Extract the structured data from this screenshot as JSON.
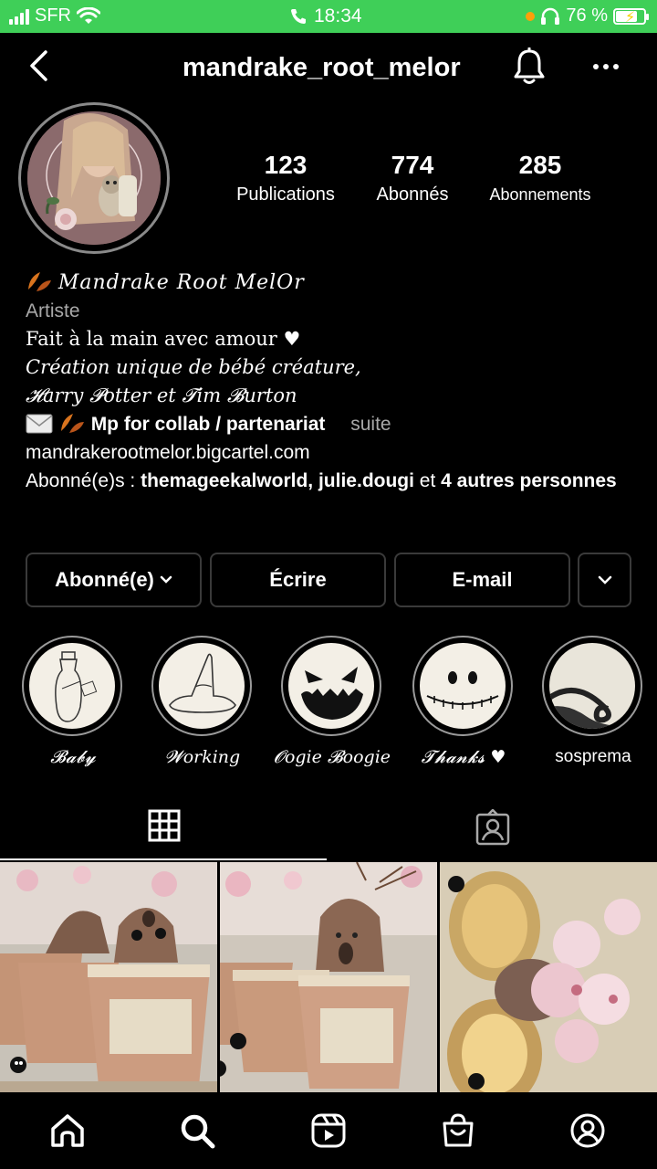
{
  "status_bar": {
    "carrier": "SFR",
    "time": "18:34",
    "battery": "76 %",
    "battery_level": 0.76,
    "color": "#3fcf58"
  },
  "header": {
    "username": "mandrake_root_melor",
    "icons": [
      "chevron-left-icon",
      "bell-icon",
      "more-dots-icon"
    ]
  },
  "stats": [
    {
      "value": "123",
      "label": "Publications"
    },
    {
      "value": "774",
      "label": "Abonnés"
    },
    {
      "value": "285",
      "label": "Abonnements"
    }
  ],
  "bio": {
    "name": "𝑀𝑎𝑛𝑑𝑟𝑎𝑘𝑒 𝑅𝑜𝑜𝑡 𝑀𝑒𝑙𝑂𝑟",
    "category": "Artiste",
    "line1": "Fait à la main avec amour",
    "line2": "Création unique de bébé créature,",
    "line3": "𝓗arry 𝓟otter et 𝓣im 𝓑urton",
    "line4": "Mp for collab / partenariat",
    "more": "suite",
    "link": "mandrakerootmelor.bigcartel.com",
    "followed_prefix": "Abonné(e)s : ",
    "followed_names": "themageekalworld, julie.dougi",
    "followed_and": " et ",
    "followed_others": "4 autres personnes"
  },
  "actions": {
    "follow": "Abonné(e)",
    "message": "Écrire",
    "email": "E-mail"
  },
  "highlights": [
    {
      "label": "𝓑𝓪𝓫𝔂"
    },
    {
      "label": "𝓦orking"
    },
    {
      "label": "𝓞ogie 𝓑oogie"
    },
    {
      "label": "𝓣𝓱𝓪𝓷𝓴𝓼 ♥"
    },
    {
      "label": "sosprema"
    }
  ],
  "tabs": [
    "grid-icon",
    "tagged-icon"
  ],
  "bottom_nav": [
    "home-icon",
    "search-icon",
    "reels-icon",
    "shop-icon",
    "profile-icon"
  ],
  "colors": {
    "background": "#000000",
    "secondary_text": "#a8a8a8",
    "button_border": "#3a3a3a"
  }
}
